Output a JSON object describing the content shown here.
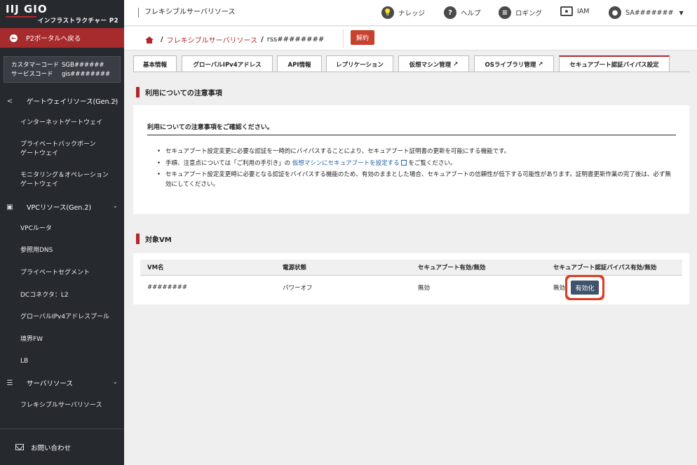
{
  "logo": {
    "main": "IIJ GIO",
    "sub": "インフラストラクチャー P2"
  },
  "sidebar": {
    "portal_back": "P2ポータルへ戻る",
    "customer": {
      "code_label": "カスタマーコード",
      "code_value": "SGB######",
      "service_label": "サービスコード",
      "service_value": "gis########"
    },
    "groups": [
      {
        "label": "ゲートウェイリソース(Gen.2)",
        "icon": "share-icon",
        "items": [
          "インターネットゲートウェイ",
          "プライベートバックボーン\nゲートウェイ",
          "モニタリング＆オペレーション\nゲートウェイ"
        ]
      },
      {
        "label": "VPCリソース(Gen.2)",
        "icon": "vpc-icon",
        "items": [
          "VPCルータ",
          "参照用DNS",
          "プライベートセグメント",
          "DCコネクタ：L2",
          "グローバルIPv4アドレスプール",
          "境界FW",
          "LB"
        ]
      },
      {
        "label": "サーバリソース",
        "icon": "server-icon",
        "items": [
          "フレキシブルサーバリソース"
        ]
      }
    ],
    "footer": "お問い合わせ"
  },
  "topbar": {
    "title": "フレキシブルサーバリソース",
    "nav": {
      "knowledge": "ナレッジ",
      "help": "ヘルプ",
      "logging": "ロギング",
      "iam": "IAM",
      "user": "SA#######"
    }
  },
  "breadcrumb": {
    "link": "フレキシブルサーバリソース",
    "current": "rss########",
    "cancel_button": "解約"
  },
  "tabs": [
    "基本情報",
    "グローバルIPv4アドレス",
    "API情報",
    "レプリケーション",
    "仮想マシン管理",
    "OSライブラリ管理",
    "セキュアブート認証バイパス設定"
  ],
  "notice": {
    "section_title": "利用についての注意事項",
    "heading": "利用についての注意事項をご確認ください。",
    "item1": "セキュアブート設定変更に必要な認証を一時的にバイパスすることにより、セキュアブート証明書の更新を可能にする機能です。",
    "item2_pre": "手順、注意点については「ご利用の手引き」の",
    "item2_link": "仮想マシンにセキュアブートを設定する",
    "item2_post": "をご覧ください。",
    "item3": "セキュアブート設定変更時に必要となる認証をバイパスする機能のため、有効のままとした場合、セキュアブートの信頼性が低下する可能性があります。証明書更新作業の完了後は、必ず無効にしてください。"
  },
  "vm": {
    "section_title": "対象VM",
    "headers": [
      "VM名",
      "電源状態",
      "セキュアブート有効/無効",
      "セキュアブート認証バイパス有効/無効"
    ],
    "row": {
      "name": "########",
      "power": "パワーオフ",
      "secure_boot": "無効",
      "bypass": "無効"
    },
    "enable_button": "有効化"
  },
  "colors": {
    "accent": "#b3262b",
    "sidebar": "#26292e",
    "enable_button": "#3f536a",
    "highlight": "#e23a20"
  }
}
